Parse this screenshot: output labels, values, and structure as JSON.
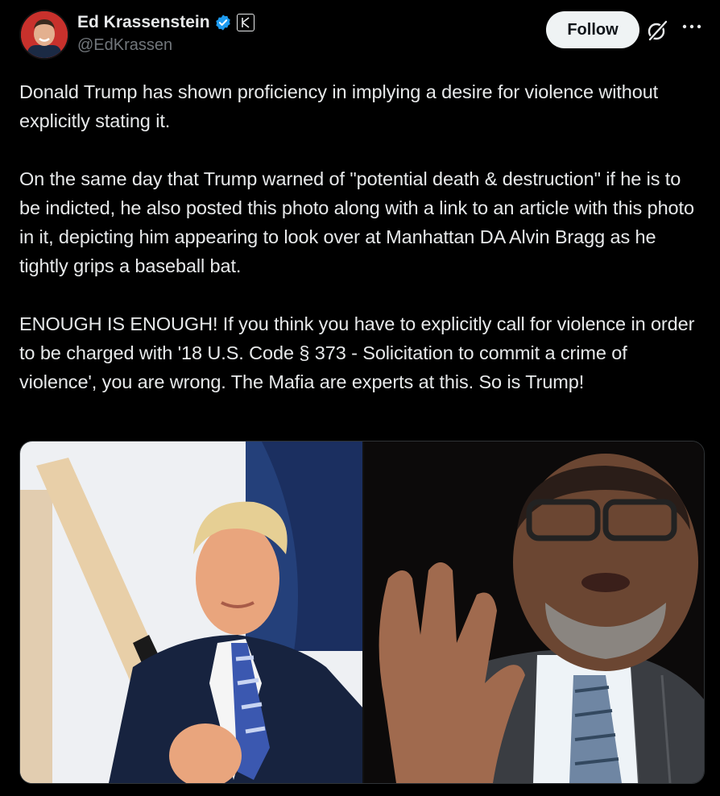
{
  "author": {
    "display_name": "Ed Krassenstein",
    "handle": "@EdKrassen",
    "verified": true,
    "affiliation_badge_letter": "K"
  },
  "actions": {
    "follow_label": "Follow",
    "grok_icon": "grok-icon",
    "more_icon": "more-icon"
  },
  "tweet": {
    "paragraphs": [
      "Donald Trump has shown proficiency in implying a desire for violence without explicitly stating it.",
      "On the same day that Trump warned of \"potential death & destruction\" if he is to be indicted, he also posted this photo along with a link to an article with this photo in it, depicting him appearing to look over at Manhattan DA Alvin Bragg as he tightly grips a baseball bat.",
      "ENOUGH IS ENOUGH! If you think you have to explicitly call for violence in order to be charged with '18 U.S. Code § 373 - Solicitation to commit a crime of violence', you are wrong. The Mafia are experts at this. So is Trump!"
    ]
  },
  "colors": {
    "background": "#000000",
    "text": "#e7e9ea",
    "secondary_text": "#71767b",
    "verified_blue": "#1d9bf0",
    "follow_bg": "#eff3f4"
  }
}
